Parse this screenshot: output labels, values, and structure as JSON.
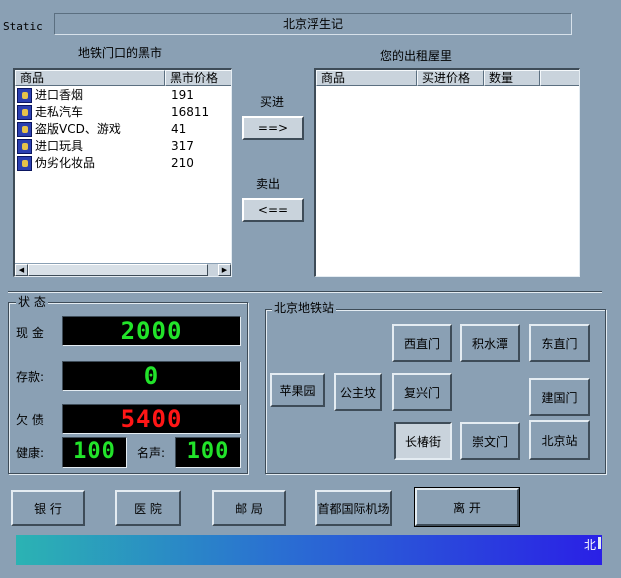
{
  "static_label": "Static",
  "window_title": "北京浮生记",
  "market": {
    "label": "地铁门口的黑市",
    "columns": [
      "商品",
      "黑市价格"
    ],
    "items": [
      {
        "name": "进口香烟",
        "price": "191"
      },
      {
        "name": "走私汽车",
        "price": "16811"
      },
      {
        "name": "盗版VCD、游戏",
        "price": "41"
      },
      {
        "name": "进口玩具",
        "price": "317"
      },
      {
        "name": "伪劣化妆品",
        "price": "210"
      }
    ]
  },
  "trade": {
    "buy_label": "买进",
    "buy_button": "==>",
    "sell_label": "卖出",
    "sell_button": "<=="
  },
  "home": {
    "label": "您的出租屋里",
    "columns": [
      "商品",
      "买进价格",
      "数量",
      ""
    ]
  },
  "status": {
    "title": "状 态",
    "cash_label": "现 金",
    "cash_value": "2000",
    "savings_label": "存款:",
    "savings_value": "0",
    "debt_label": "欠 债",
    "debt_value": "5400",
    "health_label": "健康:",
    "health_value": "100",
    "fame_label": "名声:",
    "fame_value": "100"
  },
  "stations": {
    "title": "北京地铁站",
    "items": [
      {
        "id": "xizhimen",
        "label": "西直门"
      },
      {
        "id": "jishuitan",
        "label": "积水潭"
      },
      {
        "id": "dongzhimen",
        "label": "东直门"
      },
      {
        "id": "pingguoyuan",
        "label": "苹果园"
      },
      {
        "id": "gongzhufen",
        "label": "公主坟"
      },
      {
        "id": "fuxingmen",
        "label": "复兴门"
      },
      {
        "id": "jianguomen",
        "label": "建国门"
      },
      {
        "id": "changchunjie",
        "label": "长椿街"
      },
      {
        "id": "chongwenmen",
        "label": "崇文门"
      },
      {
        "id": "beijingzhan",
        "label": "北京站"
      }
    ],
    "selected": "长椿街"
  },
  "bottom_buttons": {
    "bank": "银 行",
    "hospital": "医 院",
    "post": "邮 局",
    "airport": "首都国际机场",
    "leave": "离 开"
  },
  "ticker": {
    "text": "北"
  },
  "colors": {
    "background": "#8aa0b4",
    "lcd_green": "#22e32a",
    "lcd_red": "#ff1616"
  }
}
